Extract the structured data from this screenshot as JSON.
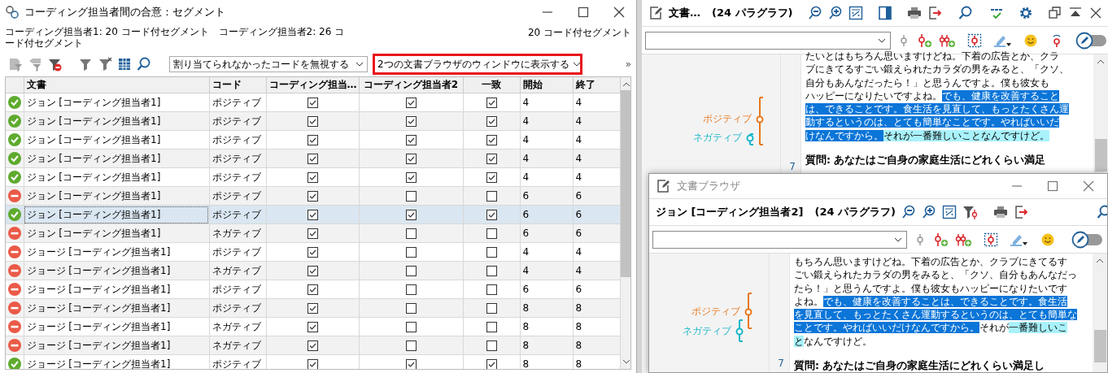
{
  "agreement_window": {
    "title": "コーディング担当者間の合意：セグメント",
    "summary": "コーディング担当者1: 20 コード付セグメント　コーディング担当者2: 26 コード付セグメント",
    "total": "20 コード付セグメント",
    "dropdowns": [
      {
        "value": "割り当てられなかったコードを無視する",
        "highlighted": false
      },
      {
        "value": "2つの文書ブラウザのウィンドウに表示する",
        "highlighted": true
      }
    ],
    "overflow": "»",
    "table": {
      "columns": [
        "文書",
        "コード",
        "コーディング担当…",
        "コーディング担当者2",
        "一致",
        "開始",
        "終了"
      ],
      "rows": [
        {
          "agree": true,
          "document": "ジョン [コーディング担当者1]",
          "code": "ポジティブ",
          "coder1": true,
          "coder2": true,
          "match": true,
          "start": "4",
          "end": "4",
          "selected": false
        },
        {
          "agree": true,
          "document": "ジョン [コーディング担当者1]",
          "code": "ポジティブ",
          "coder1": true,
          "coder2": true,
          "match": true,
          "start": "4",
          "end": "4",
          "selected": false
        },
        {
          "agree": true,
          "document": "ジョン [コーディング担当者1]",
          "code": "ポジティブ",
          "coder1": true,
          "coder2": true,
          "match": true,
          "start": "4",
          "end": "4",
          "selected": false
        },
        {
          "agree": true,
          "document": "ジョン [コーディング担当者1]",
          "code": "ポジティブ",
          "coder1": true,
          "coder2": true,
          "match": true,
          "start": "4",
          "end": "4",
          "selected": false
        },
        {
          "agree": true,
          "document": "ジョン [コーディング担当者1]",
          "code": "ポジティブ",
          "coder1": true,
          "coder2": true,
          "match": true,
          "start": "4",
          "end": "4",
          "selected": false
        },
        {
          "agree": false,
          "document": "ジョン [コーディング担当者1]",
          "code": "ポジティブ",
          "coder1": true,
          "coder2": false,
          "match": false,
          "start": "6",
          "end": "6",
          "selected": false
        },
        {
          "agree": true,
          "document": "ジョン [コーディング担当者1]",
          "code": "ポジティブ",
          "coder1": true,
          "coder2": true,
          "match": true,
          "start": "6",
          "end": "6",
          "selected": true
        },
        {
          "agree": false,
          "document": "ジョン [コーディング担当者1]",
          "code": "ネガティブ",
          "coder1": true,
          "coder2": false,
          "match": false,
          "start": "6",
          "end": "6",
          "selected": false
        },
        {
          "agree": false,
          "document": "ジョージ [コーディング担当者1]",
          "code": "ポジティブ",
          "coder1": true,
          "coder2": false,
          "match": false,
          "start": "4",
          "end": "4",
          "selected": false
        },
        {
          "agree": false,
          "document": "ジョージ [コーディング担当者1]",
          "code": "ネガティブ",
          "coder1": true,
          "coder2": false,
          "match": false,
          "start": "4",
          "end": "4",
          "selected": false
        },
        {
          "agree": false,
          "document": "ジョージ [コーディング担当者1]",
          "code": "ポジティブ",
          "coder1": true,
          "coder2": false,
          "match": false,
          "start": "6",
          "end": "6",
          "selected": false
        },
        {
          "agree": false,
          "document": "ジョージ [コーディング担当者1]",
          "code": "ポジティブ",
          "coder1": true,
          "coder2": false,
          "match": false,
          "start": "8",
          "end": "8",
          "selected": false
        },
        {
          "agree": false,
          "document": "ジョージ [コーディング担当者1]",
          "code": "ネガティブ",
          "coder1": true,
          "coder2": false,
          "match": false,
          "start": "8",
          "end": "8",
          "selected": false
        },
        {
          "agree": false,
          "document": "ジョージ [コーディング担当者1]",
          "code": "ネガティブ",
          "coder1": true,
          "coder2": false,
          "match": false,
          "start": "8",
          "end": "8",
          "selected": false
        },
        {
          "agree": true,
          "document": "ジョージ [コーディング担当者1]",
          "code": "ポジティブ",
          "coder1": true,
          "coder2": true,
          "match": true,
          "start": "8",
          "end": "8",
          "selected": false
        }
      ]
    }
  },
  "browsers": [
    {
      "kind": "docked",
      "title": "文書…",
      "paragraphs": "(24 パラグラフ)",
      "codes": [
        {
          "label": "ポジティブ",
          "color": "#e8781e"
        },
        {
          "label": "ネガティブ",
          "color": "#1ab6c8"
        }
      ],
      "lines": [
        [
          {
            "text": "たいとはもちろん思いますけどね。下着の広告とか、クラ"
          }
        ],
        [
          {
            "text": "ブにきてるすごい鍛えられたカラダの男をみると、「クソ、"
          }
        ],
        [
          {
            "text": "自分もあんなだったら！」と思うんですよ。僕も彼女も"
          }
        ],
        [
          {
            "text": "ハッピーになりたいですよね。"
          },
          {
            "text": "でも、健康を改善すること",
            "color": "#0b75d8"
          }
        ],
        [
          {
            "text": "は、できることです。食生活を見直して、もっとたくさん運",
            "color": "#0b75d8"
          }
        ],
        [
          {
            "text": "動するというのは、とても簡単なことです。やればいいだ",
            "color": "#0b75d8"
          }
        ],
        [
          {
            "text": "けなんですから。",
            "color": "#0b75d8"
          },
          {
            "text": "それが一番難しいことなんですけど。",
            "color": "#a9f2fb"
          }
        ]
      ],
      "paragraph_number": "7",
      "question": [
        "質問: あなたはご自身の家庭生活にどれくらい満足"
      ]
    },
    {
      "kind": "floating",
      "window_title": "文書ブラウザ",
      "title": "ジョン [コーディング担当者2]",
      "paragraphs": "(24 パラグラフ)",
      "codes": [
        {
          "label": "ポジティブ",
          "color": "#e8781e"
        },
        {
          "label": "ネガティブ",
          "color": "#1ab6c8"
        }
      ],
      "lines": [
        [
          {
            "text": "もちろん思いますけどね。下着の広告とか、クラブにきてるす"
          }
        ],
        [
          {
            "text": "ごい鍛えられたカラダの男をみると、「クソ、自分もあんなだっ"
          }
        ],
        [
          {
            "text": "たら！」と思うんですよ。僕も彼女もハッピーになりたいです"
          }
        ],
        [
          {
            "text": "よね。"
          },
          {
            "text": "でも、健康を改善することは、できることです。食生活",
            "color": "#0b75d8"
          }
        ],
        [
          {
            "text": "を見直して、もっとたくさん運動するというのは、とても簡単な",
            "color": "#0b75d8"
          }
        ],
        [
          {
            "text": "ことです。やればいいだけなんですから。",
            "color": "#0b75d8"
          },
          {
            "text": "それが"
          },
          {
            "text": "一番難しいこ",
            "color": "#a9f2fb"
          }
        ],
        [
          {
            "text": "と",
            "color": "#a9f2fb"
          },
          {
            "text": "なんですけど。"
          }
        ]
      ],
      "paragraph_number": "7",
      "question": [
        "質問: あなたはご自身の家庭生活にどれくらい満足し"
      ]
    }
  ]
}
